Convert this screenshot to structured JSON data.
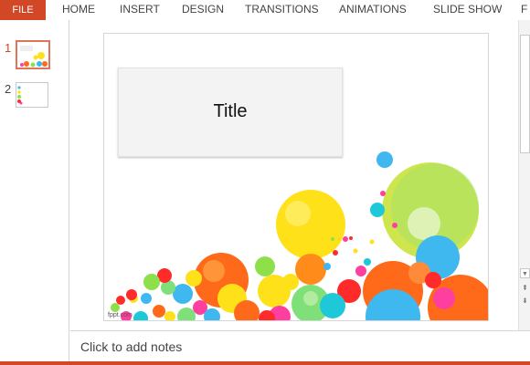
{
  "ribbon": {
    "file_label": "FILE",
    "tabs": [
      "HOME",
      "INSERT",
      "DESIGN",
      "TRANSITIONS",
      "ANIMATIONS",
      "SLIDE SHOW",
      "F"
    ]
  },
  "thumbnails": [
    {
      "number": "1",
      "active": true
    },
    {
      "number": "2",
      "active": false
    }
  ],
  "slide": {
    "title": "Title",
    "credit": "fppt.com"
  },
  "notes": {
    "placeholder": "Click to add notes"
  },
  "colors": {
    "accent": "#d24726",
    "bubble_palette": [
      "#ffe11a",
      "#ff6a1a",
      "#3fb8f0",
      "#8ee04a",
      "#ff3fa0",
      "#ff2a2a",
      "#1fc8d8",
      "#7fe07a"
    ]
  },
  "icons": [
    "scroll-up-icon",
    "scroll-down-icon",
    "previous-slide-icon",
    "next-slide-icon"
  ]
}
